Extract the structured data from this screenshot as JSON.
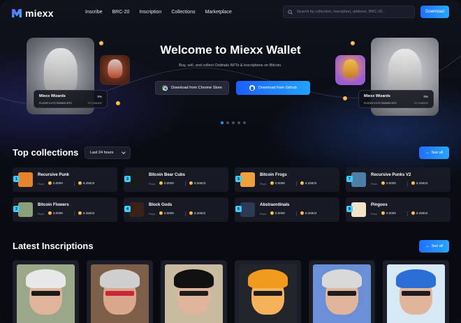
{
  "brand": {
    "name": "miexx"
  },
  "nav": {
    "items": [
      "Inscribe",
      "BRC-20",
      "Inscription",
      "Collections",
      "Marketplace"
    ],
    "search_placeholder": "Search by collection, inscription, address, BRC-20...",
    "download_label": "Download"
  },
  "hero": {
    "title": "Welcome to Miexx Wallet",
    "subtitle": "Buy, sell, and collect Ordinals NFTs & inscriptions on Bitcoin.",
    "chrome_label": "Download from Chrome Store",
    "github_label": "Download from Github",
    "left_card": {
      "name": "Miexx Wizards",
      "change": "0%",
      "floor": "FLOOR 0.0717520000 BTC",
      "change_label": "7D CHANGE"
    },
    "right_card": {
      "name": "Miexx Wizards",
      "change": "0%",
      "floor": "FLOOR 0.0717520000 BTC",
      "change_label": "7D CHANGE"
    },
    "carousel_total": 5,
    "carousel_active": 1
  },
  "top_collections": {
    "title": "Top collections",
    "period": "Last 24 hours",
    "see_all": "See all",
    "floor_label": "Floor",
    "items": [
      {
        "rank": "1",
        "name": "Recursive Punk",
        "v1": "0.0009",
        "v2": "8.25823",
        "color": "#e6832b"
      },
      {
        "rank": "2",
        "name": "Bitcoin Flowers",
        "v1": "0.0009",
        "v2": "8.25823",
        "color": "#8aa07a"
      },
      {
        "rank": "3",
        "name": "Bitcoin Bear Cubs",
        "v1": "0.0009",
        "v2": "8.25823",
        "color": "#1a1a1a"
      },
      {
        "rank": "4",
        "name": "Block Gods",
        "v1": "0.0009",
        "v2": "8.25823",
        "color": "#3a2218"
      },
      {
        "rank": "5",
        "name": "Bitcoin Frogs",
        "v1": "0.0009",
        "v2": "8.25823",
        "color": "#f0a23a"
      },
      {
        "rank": "6",
        "name": "Abstraordinals",
        "v1": "0.0009",
        "v2": "8.25823",
        "color": "#2b3a55"
      },
      {
        "rank": "7",
        "name": "Recursive Punks V2",
        "v1": "0.0009",
        "v2": "8.25823",
        "color": "#4d7ea8"
      },
      {
        "rank": "8",
        "name": "Pingoos",
        "v1": "0.0009",
        "v2": "8.25823",
        "color": "#f2e2c6"
      }
    ]
  },
  "latest_inscriptions": {
    "title": "Latest Inscriptions",
    "see_all": "See all",
    "items": [
      {
        "bg": "#9aa889",
        "hair": "#e8e8e8",
        "face": "#e0b59c",
        "glasses": "#1a1a1a"
      },
      {
        "bg": "#7e5f49",
        "hair": "#cfcfcf",
        "face": "#d9a78a",
        "glasses": "#c8263a"
      },
      {
        "bg": "#c9bba0",
        "hair": "#111111",
        "face": "#e0b59c",
        "glasses": "#1d1d1d"
      },
      {
        "bg": "#23252c",
        "hair": "#f29a1d",
        "face": "#f4b25a",
        "glasses": "#1d1d1d"
      },
      {
        "bg": "#6b8fd6",
        "hair": "#d9d9d9",
        "face": "#e0b59c",
        "glasses": "#1d1d1d"
      },
      {
        "bg": "#d6e9f5",
        "hair": "#2b6fd6",
        "face": "#e0b59c",
        "glasses": "#1d1d1d"
      }
    ]
  }
}
